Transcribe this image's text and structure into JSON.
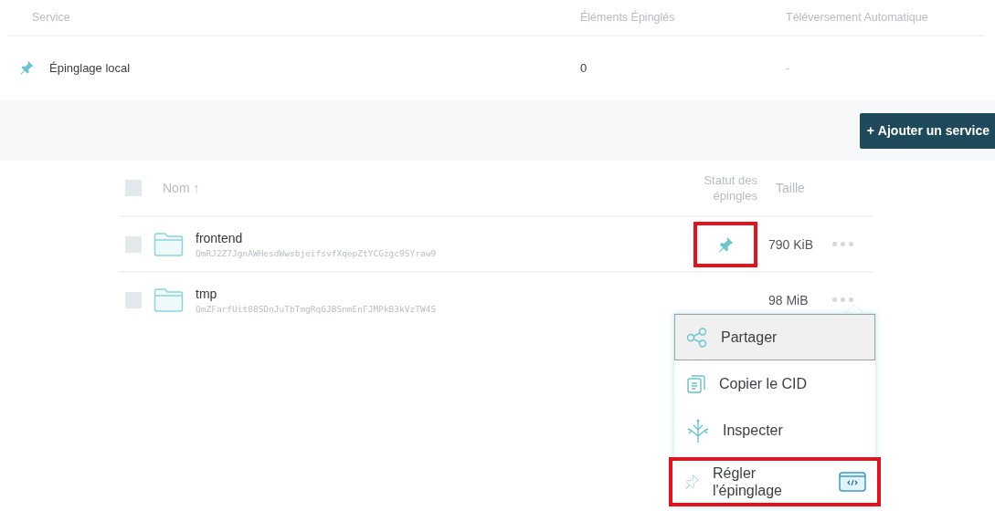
{
  "services": {
    "columns": [
      "Service",
      "Éléments Épinglés",
      "Téléversement Automatique"
    ],
    "rows": [
      {
        "name": "Épinglage local",
        "pinned": "0",
        "auto_upload": "-"
      }
    ]
  },
  "add_service": {
    "icon": "+",
    "label": "Ajouter un service"
  },
  "files": {
    "select_all": {
      "checked": false
    },
    "columns": {
      "name": "Nom ↑",
      "status": "Statut des épingles",
      "size": "Taille"
    },
    "rows": [
      {
        "checked": false,
        "name": "frontend",
        "cid": "QmRJ2Z7JgnAWHesdWwsbjeifsvfXqepZtYCGzgc9SYraw9",
        "pinned": true,
        "highlighted": true,
        "size": "790 KiB"
      },
      {
        "checked": false,
        "name": "tmp",
        "cid": "QmZFarfUit88SDnJuTbTmgRq6JBSnmEnFJMPkB3kVzTW4S",
        "pinned": false,
        "highlighted": false,
        "size": "98 MiB"
      }
    ]
  },
  "context_menu": {
    "items": [
      {
        "label": "Partager",
        "selected": true,
        "highlighted": false,
        "extra_icon": false
      },
      {
        "label": "Copier le CID",
        "selected": false,
        "highlighted": false,
        "extra_icon": false
      },
      {
        "label": "Inspecter",
        "selected": false,
        "highlighted": false,
        "extra_icon": false
      },
      {
        "label": "Régler l'épinglage",
        "selected": false,
        "highlighted": true,
        "extra_icon": true
      }
    ]
  }
}
